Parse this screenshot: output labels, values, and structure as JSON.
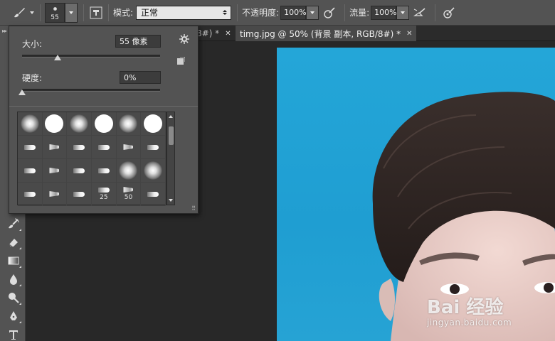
{
  "options_bar": {
    "brush_size_preview": "55",
    "mode_label": "模式:",
    "mode_value": "正常",
    "opacity_label": "不透明度:",
    "opacity_value": "100%",
    "flow_label": "流量:",
    "flow_value": "100%",
    "icons": [
      "brush-tool-icon",
      "brush-panel-toggle-icon",
      "opacity-pressure-icon",
      "airbrush-icon",
      "size-pressure-icon"
    ]
  },
  "document_tabs": [
    {
      "label": "8#) *",
      "active": false
    },
    {
      "label": "timg.jpg @ 50% (背景 副本, RGB/8#) *",
      "active": true
    }
  ],
  "brush_picker": {
    "size_label": "大小:",
    "size_value": "55 像素",
    "hardness_label": "硬度:",
    "hardness_value": "0%",
    "size_slider_fraction": 0.27,
    "hardness_slider_fraction": 0.0,
    "presets": [
      {
        "kind": "soft",
        "label": ""
      },
      {
        "kind": "hard",
        "label": ""
      },
      {
        "kind": "soft",
        "label": ""
      },
      {
        "kind": "hard",
        "label": ""
      },
      {
        "kind": "soft",
        "label": ""
      },
      {
        "kind": "hard",
        "label": ""
      },
      {
        "kind": "tip",
        "label": ""
      },
      {
        "kind": "tip",
        "label": ""
      },
      {
        "kind": "tip",
        "label": ""
      },
      {
        "kind": "tip",
        "label": ""
      },
      {
        "kind": "tip",
        "label": ""
      },
      {
        "kind": "tip",
        "label": ""
      },
      {
        "kind": "tip",
        "label": ""
      },
      {
        "kind": "tip",
        "label": ""
      },
      {
        "kind": "tip",
        "label": ""
      },
      {
        "kind": "tip",
        "label": ""
      },
      {
        "kind": "soft",
        "label": ""
      },
      {
        "kind": "soft",
        "label": ""
      },
      {
        "kind": "tip",
        "label": ""
      },
      {
        "kind": "tip",
        "label": ""
      },
      {
        "kind": "tip",
        "label": ""
      },
      {
        "kind": "tip",
        "label": "25"
      },
      {
        "kind": "tip",
        "label": "50"
      },
      {
        "kind": "tip",
        "label": ""
      }
    ]
  },
  "watermark": {
    "main": "Bai 经验",
    "sub": "jingyan.baidu.com"
  },
  "colors": {
    "panel": "#535353",
    "canvas_bg": "#282828",
    "photo_sky": "#1f9ed2"
  }
}
